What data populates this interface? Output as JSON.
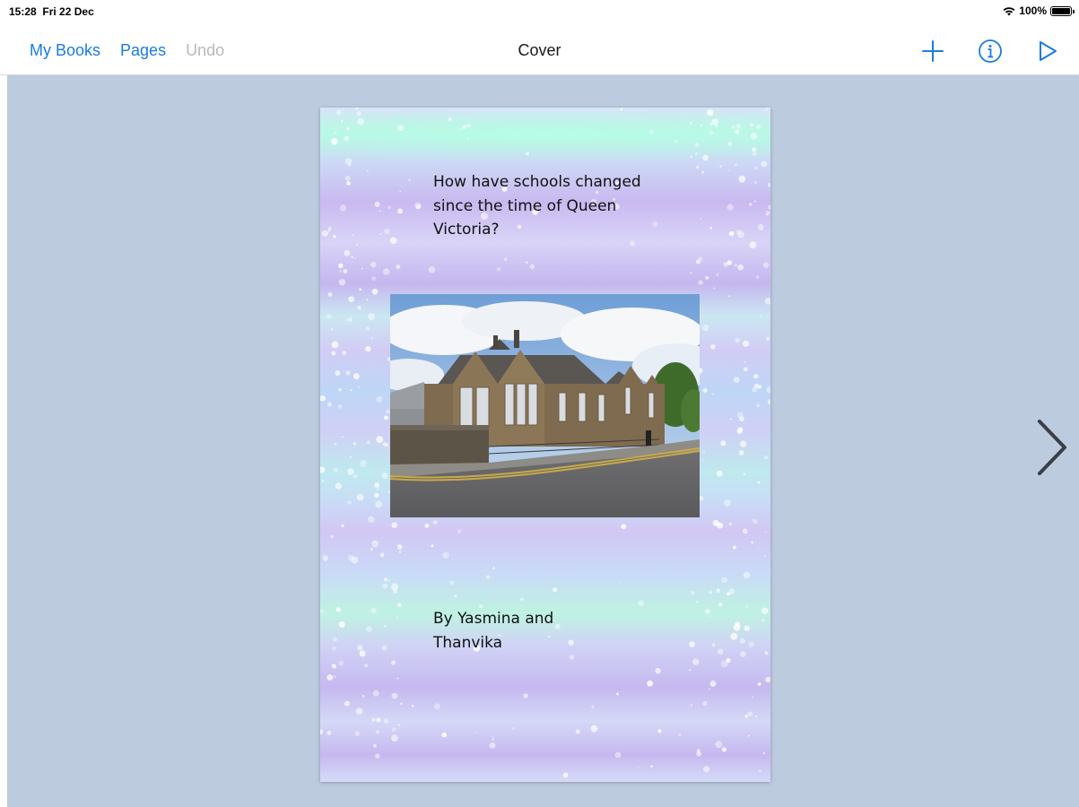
{
  "status_bar": {
    "time": "15:28",
    "date": "Fri 22 Dec",
    "battery": "100%",
    "battery_level": 1.0
  },
  "nav": {
    "my_books": "My Books",
    "pages": "Pages",
    "undo": "Undo",
    "title": "Cover",
    "icons": [
      "plus-icon",
      "info-icon",
      "play-icon"
    ]
  },
  "page": {
    "title": "How have schools changed since the time of Queen Victoria?",
    "author_line1": "By Yasmina and",
    "author_line2": "Thanvika",
    "photo_icon": "school-building-photo"
  },
  "colors": {
    "accent": "#1a7be0",
    "disabled": "#b9b9b9",
    "canvas": "#bccbde"
  }
}
